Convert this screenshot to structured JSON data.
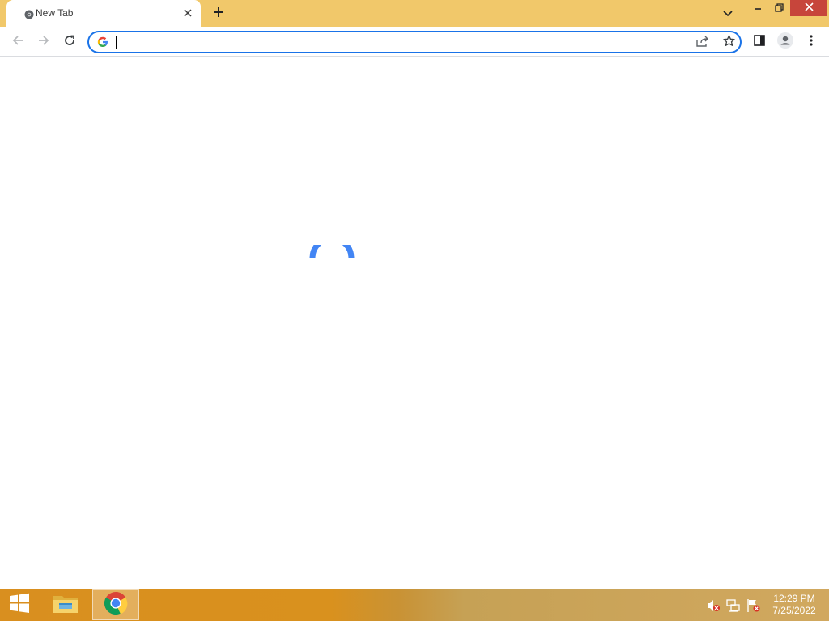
{
  "browser": {
    "tab": {
      "title": "New Tab"
    },
    "omnibox": {
      "value": "",
      "placeholder": ""
    }
  },
  "taskbar": {
    "clock": {
      "time": "12:29 PM",
      "date": "7/25/2022"
    }
  },
  "colors": {
    "tabstrip": "#f1c86a",
    "accent": "#1a73e8",
    "close_button": "#c7453b"
  },
  "icons": [
    "chrome-favicon-icon",
    "close-icon",
    "plus-icon",
    "chevron-down-icon",
    "minimize-icon",
    "restore-icon",
    "back-arrow-icon",
    "forward-arrow-icon",
    "reload-icon",
    "google-g-icon",
    "share-icon",
    "star-icon",
    "side-panel-icon",
    "profile-icon",
    "kebab-menu-icon",
    "loading-spinner-icon",
    "windows-start-icon",
    "file-explorer-icon",
    "chrome-icon",
    "volume-muted-icon",
    "network-icon",
    "action-center-flag-icon"
  ]
}
